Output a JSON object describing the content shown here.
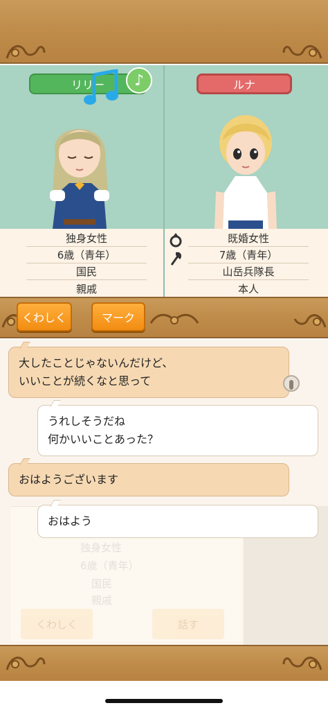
{
  "characters": {
    "left": {
      "name": "リリー",
      "tag_color": "#54b65c",
      "status": [
        "独身女性",
        "6歳（青年）",
        "国民",
        "親戚"
      ]
    },
    "right": {
      "name": "ルナ",
      "tag_color": "#e46a6a",
      "status": [
        "既婚女性",
        "7歳（青年）",
        "山岳兵隊長",
        "本人"
      ]
    }
  },
  "buttons": {
    "details_label": "くわしく",
    "mark_label": "マーク"
  },
  "chat": {
    "messages": [
      {
        "side": "them",
        "lines": [
          "大したことじゃないんだけど、",
          "いいことが続くなと思って"
        ]
      },
      {
        "side": "me",
        "lines": [
          "うれしそうだね",
          "何かいいことあった？"
        ]
      },
      {
        "side": "them",
        "lines": [
          "おはようございます"
        ]
      },
      {
        "side": "me",
        "lines": [
          "おはよう"
        ]
      }
    ]
  },
  "background_panel": {
    "status": [
      "独身女性",
      "6歳（青年）",
      "国民",
      "親戚"
    ],
    "details_label": "くわしく",
    "talk_label": "話す"
  },
  "icons": [
    "note-badge-icon",
    "music-note-icon",
    "ring-icon",
    "axe-icon",
    "touch-icon"
  ],
  "colors": {
    "wood": "#bf8c4a",
    "panel_bg": "#a9d3c2",
    "orange": "#f28d12"
  }
}
